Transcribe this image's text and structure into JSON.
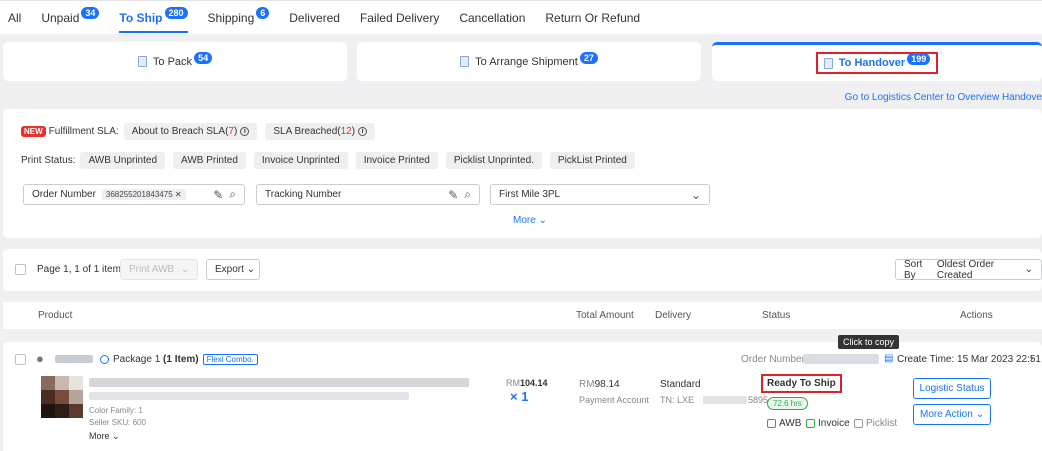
{
  "top_tabs": [
    {
      "label": "All",
      "badge": null
    },
    {
      "label": "Unpaid",
      "badge": "34"
    },
    {
      "label": "To Ship",
      "badge": "280",
      "active": true
    },
    {
      "label": "Shipping",
      "badge": "6"
    },
    {
      "label": "Delivered",
      "badge": null
    },
    {
      "label": "Failed Delivery",
      "badge": null
    },
    {
      "label": "Cancellation",
      "badge": null
    },
    {
      "label": "Return Or Refund",
      "badge": null
    }
  ],
  "sub_tabs": {
    "to_pack": {
      "label": "To Pack",
      "badge": "54"
    },
    "to_arrange": {
      "label": "To Arrange Shipment",
      "badge": "27"
    },
    "to_handover": {
      "label": "To Handover",
      "badge": "199"
    }
  },
  "logistics_link": "Go to Logistics Center to Overview Handove",
  "filters": {
    "new_tag": "NEW",
    "sla_label": "Fulfillment SLA:",
    "sla_chips": [
      {
        "text": "About to Breach SLA(",
        "count": "7",
        "close": ")"
      },
      {
        "text": "SLA Breached(",
        "count": "12",
        "close": ")"
      }
    ],
    "print_label": "Print Status:",
    "print_chips": [
      "AWB Unprinted",
      "AWB Printed",
      "Invoice Unprinted",
      "Invoice Printed",
      "Picklist Unprinted.",
      "PickList Printed"
    ],
    "order_number_label": "Order Number",
    "order_number_value": "368255201843475",
    "tracking_placeholder": "Tracking Number",
    "first_mile_value": "First Mile 3PL",
    "more": "More"
  },
  "action_bar": {
    "page_info": "Page 1, 1 of 1 item",
    "print_awb": "Print AWB",
    "export": "Export",
    "sort_label": "Sort By",
    "sort_value": "Oldest Order Created"
  },
  "table_header": {
    "product": "Product",
    "total": "Total Amount",
    "delivery": "Delivery",
    "status": "Status",
    "actions": "Actions"
  },
  "tooltip": "Click to copy",
  "order": {
    "package": "Package 1",
    "item_count": "(1 Item)",
    "combo": "Flexi Combo.",
    "order_number_label": "Order Number:",
    "create_time": "Create Time: 15 Mar 2023 22:51",
    "color_family": "Color Family: 1",
    "seller_sku": "Seller SKU: 600",
    "more": "More",
    "unit_price_currency": "RM",
    "unit_price": "104.14",
    "qty": "× 1",
    "total_currency": "RM",
    "total": "98.14",
    "payment": "Payment Account",
    "delivery": "Standard",
    "tn_label": "TN: LXE",
    "tn_tail": "5895",
    "status": "Ready To Ship",
    "hrs": "72.6 hrs",
    "docs": [
      "AWB",
      "Invoice",
      "Picklist"
    ],
    "logistic_btn": "Logistic Status",
    "more_action_btn": "More Action"
  }
}
